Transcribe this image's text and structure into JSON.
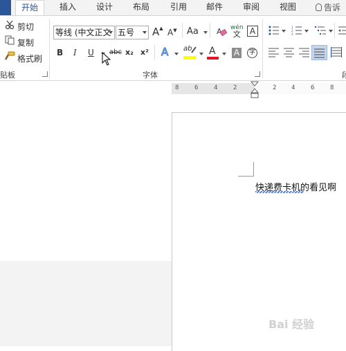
{
  "tabs": [
    {
      "label": "开始",
      "active": true
    },
    {
      "label": "插入"
    },
    {
      "label": "设计"
    },
    {
      "label": "布局"
    },
    {
      "label": "引用"
    },
    {
      "label": "邮件"
    },
    {
      "label": "审阅"
    },
    {
      "label": "视图"
    }
  ],
  "tell_me": "告诉",
  "clipboard": {
    "cut": "剪切",
    "copy": "复制",
    "format_painter": "格式刷",
    "group_label": "贴板"
  },
  "font": {
    "font_name": "等线 (中文正文",
    "font_size": "五号",
    "grow_icon": "A",
    "shrink_icon": "A",
    "case_label": "Aa",
    "wen_label": "wén",
    "border_char": "A",
    "bold": "B",
    "italic": "I",
    "underline": "U",
    "strikethrough": "abc",
    "subscript": "x₂",
    "superscript": "x²",
    "text_effect": "A",
    "highlight_label": "ab",
    "font_color_label": "A",
    "shading_label": "A",
    "circled_char": "字",
    "group_label": "字体"
  },
  "paragraph": {
    "group_label": "段"
  },
  "ruler": {
    "left_numbers": [
      "8",
      "6",
      "4",
      "2"
    ],
    "right_numbers": [
      "2",
      "4",
      "6",
      "8"
    ]
  },
  "document": {
    "text": "快递费卡机的看见啊"
  },
  "watermark": "Bai 经验",
  "colors": {
    "accent": "#2b579a",
    "highlight": "#ffff00",
    "font_color": "#e81123"
  }
}
